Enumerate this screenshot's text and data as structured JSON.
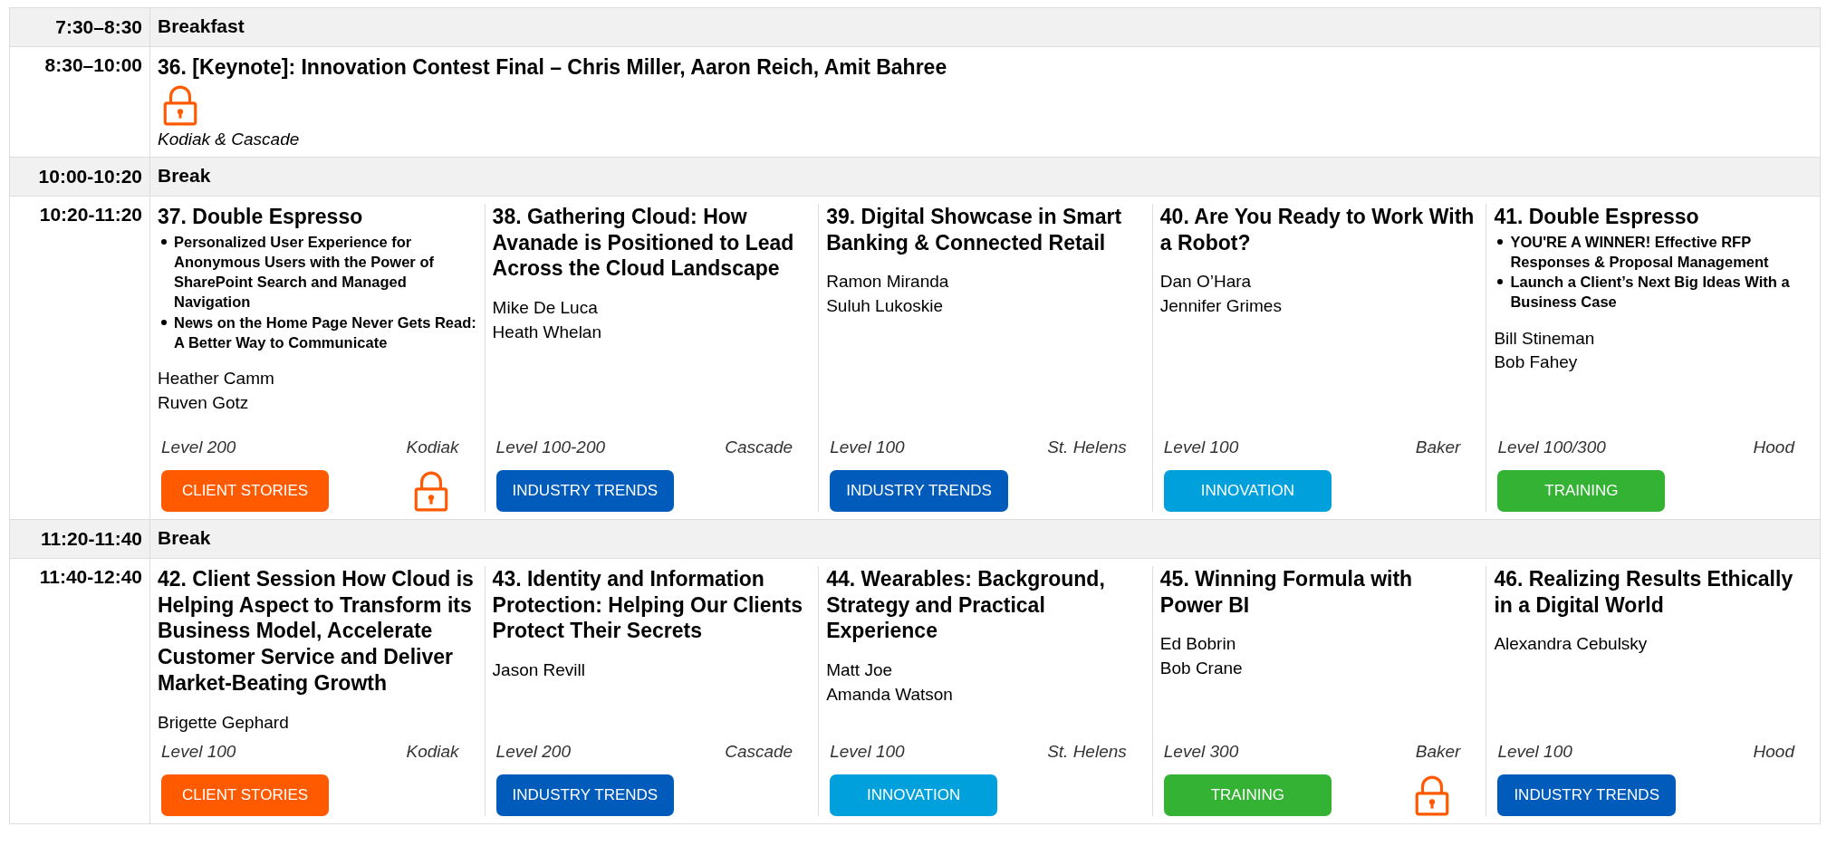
{
  "schedule": [
    {
      "kind": "plain",
      "time": "7:30–8:30",
      "title": "Breakfast"
    },
    {
      "kind": "keynote",
      "time": "8:30–10:00",
      "title": "36. [Keynote]: Innovation Contest Final – Chris Miller, Aaron Reich, Amit Bahree",
      "locked": true,
      "room": "Kodiak & Cascade"
    },
    {
      "kind": "plain",
      "time": "10:00-10:20",
      "title": "Break"
    },
    {
      "kind": "sessions",
      "time": "10:20-11:20",
      "sessions": [
        {
          "title": "37. Double Espresso",
          "bullets": [
            "Personalized User Experience for Anonymous Users with the Power of SharePoint Search and Managed Navigation",
            "News on the Home Page Never Gets Read: A Better Way to Communicate"
          ],
          "speakers": [
            "Heather Camm",
            "Ruven Gotz"
          ],
          "level": "Level 200",
          "room": "Kodiak",
          "tag": {
            "label": "CLIENT STORIES",
            "color": "#ff5a00"
          },
          "locked": true
        },
        {
          "title": "38. Gathering Cloud: How Avanade is Positioned to Lead Across the Cloud Landscape",
          "speakers": [
            "Mike De Luca",
            "Heath Whelan"
          ],
          "level": "Level 100-200",
          "room": "Cascade",
          "tag": {
            "label": "INDUSTRY TRENDS",
            "color": "#005bbb"
          },
          "locked": false
        },
        {
          "title": "39. Digital Showcase in Smart Banking & Connected Retail",
          "speakers": [
            "Ramon Miranda",
            "Suluh Lukoskie"
          ],
          "level": "Level 100",
          "room": "St. Helens",
          "tag": {
            "label": "INDUSTRY TRENDS",
            "color": "#005bbb"
          },
          "locked": false
        },
        {
          "title": "40. Are You Ready to Work With a Robot?",
          "speakers": [
            "Dan O’Hara",
            "Jennifer Grimes"
          ],
          "level": "Level 100",
          "room": "Baker",
          "tag": {
            "label": "INNOVATION",
            "color": "#00a0dc"
          },
          "locked": false
        },
        {
          "title": "41. Double Espresso",
          "bullets": [
            "YOU'RE A WINNER! Effective RFP Responses & Proposal Management",
            "Launch a Client’s Next Big Ideas With a Business Case"
          ],
          "speakers": [
            "Bill Stineman",
            "Bob Fahey"
          ],
          "level": "Level 100/300",
          "room": "Hood",
          "tag": {
            "label": "TRAINING",
            "color": "#34b233"
          },
          "locked": false
        }
      ]
    },
    {
      "kind": "plain",
      "time": "11:20-11:40",
      "title": "Break"
    },
    {
      "kind": "sessions",
      "time": "11:40-12:40",
      "sessions": [
        {
          "title": "42. Client Session How Cloud is Helping Aspect to Transform its Business Model, Accelerate Customer Service and Deliver Market-Beating Growth",
          "speakers": [
            "Brigette Gephard"
          ],
          "level": "Level 100",
          "room": "Kodiak",
          "tag": {
            "label": "CLIENT STORIES",
            "color": "#ff5a00"
          },
          "locked": false
        },
        {
          "title": "43. Identity and Information Protection: Helping Our Clients Protect Their Secrets",
          "speakers": [
            "Jason Revill"
          ],
          "level": "Level 200",
          "room": "Cascade",
          "tag": {
            "label": "INDUSTRY TRENDS",
            "color": "#005bbb"
          },
          "locked": false
        },
        {
          "title": "44. Wearables: Background, Strategy and Practical Experience",
          "speakers": [
            "Matt Joe",
            "Amanda Watson"
          ],
          "level": "Level 100",
          "room": "St. Helens",
          "tag": {
            "label": "INNOVATION",
            "color": "#00a0dc"
          },
          "locked": false
        },
        {
          "title": "45. Winning Formula with Power BI",
          "speakers": [
            "Ed Bobrin",
            "Bob Crane"
          ],
          "level": "Level 300",
          "room": "Baker",
          "tag": {
            "label": "TRAINING",
            "color": "#34b233"
          },
          "locked": true
        },
        {
          "title": "46. Realizing Results Ethically in a Digital World",
          "speakers": [
            "Alexandra Cebulsky"
          ],
          "level": "Level 100",
          "room": "Hood",
          "tag": {
            "label": "INDUSTRY TRENDS",
            "color": "#005bbb"
          },
          "locked": false
        }
      ]
    }
  ]
}
